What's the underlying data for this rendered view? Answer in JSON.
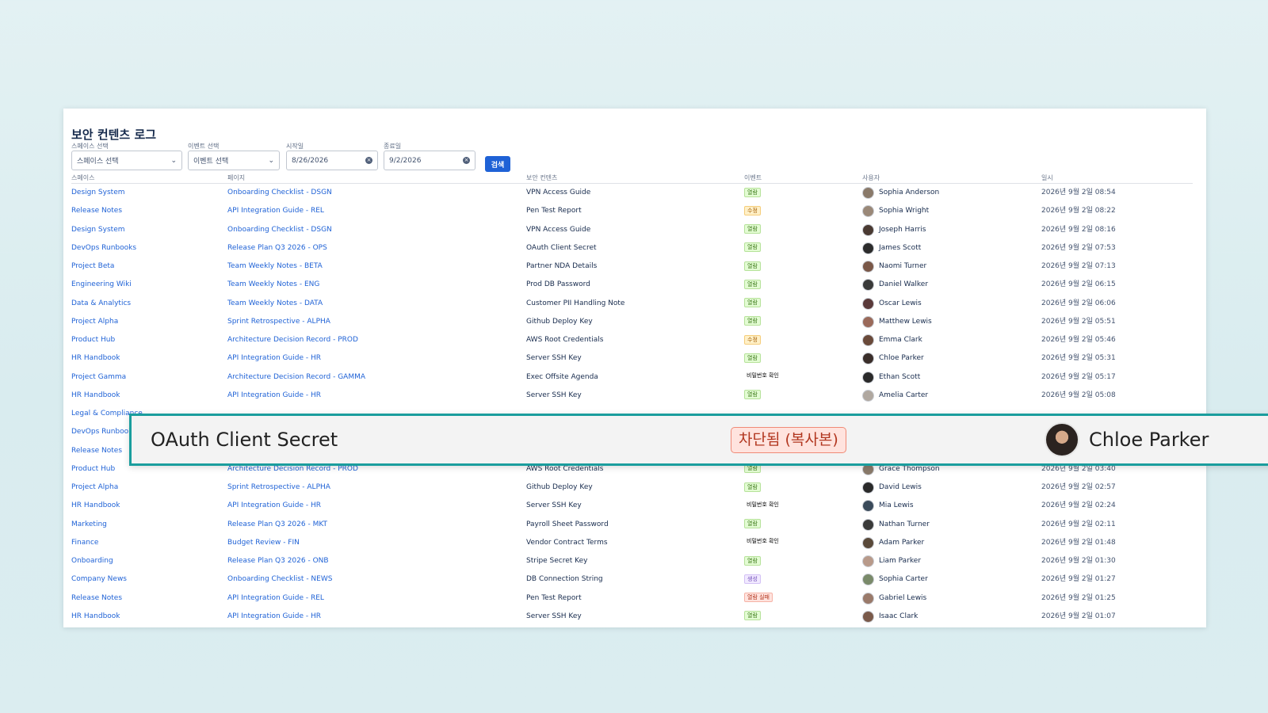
{
  "page": {
    "title": "보안 컨텐츠 로그"
  },
  "filters": {
    "space": {
      "label": "스페이스 선택",
      "value": "스페이스 선택"
    },
    "event": {
      "label": "이벤트 선택",
      "value": "이벤트 선택"
    },
    "start": {
      "label": "시작일",
      "value": "8/26/2026"
    },
    "end": {
      "label": "종료일",
      "value": "9/2/2026"
    },
    "search_label": "검색"
  },
  "columns": {
    "space": "스페이스",
    "page": "페이지",
    "content": "보안 컨텐츠",
    "event": "이벤트",
    "user": "사용자",
    "date": "일시"
  },
  "colors": {
    "accent": "#1f62d6",
    "highlight_border": "#1a9d9d",
    "view": "#e3fcd3",
    "edit": "#fff0c7",
    "password": "#e9f0ff",
    "create": "#f1e9ff",
    "fail": "#ffe3de"
  },
  "rows": [
    {
      "space": "Design System",
      "page": "Onboarding Checklist - DSGN",
      "content": "VPN Access Guide",
      "event": "열람",
      "event_type": "view",
      "user": "Sophia Anderson",
      "avatar_color": "#8a7a6a",
      "date": "2026년 9월 2일 08:54"
    },
    {
      "space": "Release Notes",
      "page": "API Integration Guide - REL",
      "content": "Pen Test Report",
      "event": "수정",
      "event_type": "edit",
      "user": "Sophia Wright",
      "avatar_color": "#9a8878",
      "date": "2026년 9월 2일 08:22"
    },
    {
      "space": "Design System",
      "page": "Onboarding Checklist - DSGN",
      "content": "VPN Access Guide",
      "event": "열람",
      "event_type": "view",
      "user": "Joseph Harris",
      "avatar_color": "#4a3a32",
      "date": "2026년 9월 2일 08:16"
    },
    {
      "space": "DevOps Runbooks",
      "page": "Release Plan Q3 2026 - OPS",
      "content": "OAuth Client Secret",
      "event": "열람",
      "event_type": "view",
      "user": "James Scott",
      "avatar_color": "#2c2c2c",
      "date": "2026년 9월 2일 07:53"
    },
    {
      "space": "Project Beta",
      "page": "Team Weekly Notes - BETA",
      "content": "Partner NDA Details",
      "event": "열람",
      "event_type": "view",
      "user": "Naomi Turner",
      "avatar_color": "#7a5848",
      "date": "2026년 9월 2일 07:13"
    },
    {
      "space": "Engineering Wiki",
      "page": "Team Weekly Notes - ENG",
      "content": "Prod DB Password",
      "event": "열람",
      "event_type": "view",
      "user": "Daniel Walker",
      "avatar_color": "#3a3a3a",
      "date": "2026년 9월 2일 06:15"
    },
    {
      "space": "Data & Analytics",
      "page": "Team Weekly Notes - DATA",
      "content": "Customer PII Handling Note",
      "event": "열람",
      "event_type": "view",
      "user": "Oscar Lewis",
      "avatar_color": "#5a3a3a",
      "date": "2026년 9월 2일 06:06"
    },
    {
      "space": "Project Alpha",
      "page": "Sprint Retrospective - ALPHA",
      "content": "Github Deploy Key",
      "event": "열람",
      "event_type": "view",
      "user": "Matthew Lewis",
      "avatar_color": "#9a6a5a",
      "date": "2026년 9월 2일 05:51"
    },
    {
      "space": "Product Hub",
      "page": "Architecture Decision Record - PROD",
      "content": "AWS Root Credentials",
      "event": "수정",
      "event_type": "edit",
      "user": "Emma Clark",
      "avatar_color": "#6a4a3a",
      "date": "2026년 9월 2일 05:46"
    },
    {
      "space": "HR Handbook",
      "page": "API Integration Guide - HR",
      "content": "Server SSH Key",
      "event": "열람",
      "event_type": "view",
      "user": "Chloe Parker",
      "avatar_color": "#3a2e2a",
      "date": "2026년 9월 2일 05:31"
    },
    {
      "space": "Project Gamma",
      "page": "Architecture Decision Record - GAMMA",
      "content": "Exec Offsite Agenda",
      "event": "비밀번호 확인",
      "event_type": "password",
      "user": "Ethan Scott",
      "avatar_color": "#2a2a2a",
      "date": "2026년 9월 2일 05:17"
    },
    {
      "space": "HR Handbook",
      "page": "API Integration Guide - HR",
      "content": "Server SSH Key",
      "event": "열람",
      "event_type": "view",
      "user": "Amelia Carter",
      "avatar_color": "#b0a8a0",
      "date": "2026년 9월 2일 05:08"
    },
    {
      "space": "Legal & Compliance",
      "page": "",
      "content": "",
      "event": "",
      "event_type": "",
      "user": "",
      "avatar_color": "",
      "date": ""
    },
    {
      "space": "DevOps Runbooks",
      "page": "",
      "content": "",
      "event": "",
      "event_type": "",
      "user": "",
      "avatar_color": "",
      "date": ""
    },
    {
      "space": "Release Notes",
      "page": "",
      "content": "",
      "event": "",
      "event_type": "",
      "user": "",
      "avatar_color": "",
      "date": ""
    },
    {
      "space": "Product Hub",
      "page": "Architecture Decision Record - PROD",
      "content": "AWS Root Credentials",
      "event": "열람",
      "event_type": "view",
      "user": "Grace Thompson",
      "avatar_color": "#8a7a6a",
      "date": "2026년 9월 2일 03:40"
    },
    {
      "space": "Project Alpha",
      "page": "Sprint Retrospective - ALPHA",
      "content": "Github Deploy Key",
      "event": "열람",
      "event_type": "view",
      "user": "David Lewis",
      "avatar_color": "#2a2a2a",
      "date": "2026년 9월 2일 02:57"
    },
    {
      "space": "HR Handbook",
      "page": "API Integration Guide - HR",
      "content": "Server SSH Key",
      "event": "비밀번호 확인",
      "event_type": "password",
      "user": "Mia Lewis",
      "avatar_color": "#3a4a5a",
      "date": "2026년 9월 2일 02:24"
    },
    {
      "space": "Marketing",
      "page": "Release Plan Q3 2026 - MKT",
      "content": "Payroll Sheet Password",
      "event": "열람",
      "event_type": "view",
      "user": "Nathan Turner",
      "avatar_color": "#3a3a3a",
      "date": "2026년 9월 2일 02:11"
    },
    {
      "space": "Finance",
      "page": "Budget Review - FIN",
      "content": "Vendor Contract Terms",
      "event": "비밀번호 확인",
      "event_type": "password",
      "user": "Adam Parker",
      "avatar_color": "#5a4a3a",
      "date": "2026년 9월 2일 01:48"
    },
    {
      "space": "Onboarding",
      "page": "Release Plan Q3 2026 - ONB",
      "content": "Stripe Secret Key",
      "event": "열람",
      "event_type": "view",
      "user": "Liam Parker",
      "avatar_color": "#b89a8a",
      "date": "2026년 9월 2일 01:30"
    },
    {
      "space": "Company News",
      "page": "Onboarding Checklist - NEWS",
      "content": "DB Connection String",
      "event": "생성",
      "event_type": "create",
      "user": "Sophia Carter",
      "avatar_color": "#7a8a6a",
      "date": "2026년 9월 2일 01:27"
    },
    {
      "space": "Release Notes",
      "page": "API Integration Guide - REL",
      "content": "Pen Test Report",
      "event": "열람 실패",
      "event_type": "fail",
      "user": "Gabriel Lewis",
      "avatar_color": "#9a7a6a",
      "date": "2026년 9월 2일 01:25"
    },
    {
      "space": "HR Handbook",
      "page": "API Integration Guide - HR",
      "content": "Server SSH Key",
      "event": "열람",
      "event_type": "view",
      "user": "Isaac Clark",
      "avatar_color": "#7a5a4a",
      "date": "2026년 9월 2일 01:07"
    }
  ],
  "zoom": {
    "content": "OAuth Client Secret",
    "event": "차단됨 (복사본)",
    "user": "Chloe Parker"
  }
}
